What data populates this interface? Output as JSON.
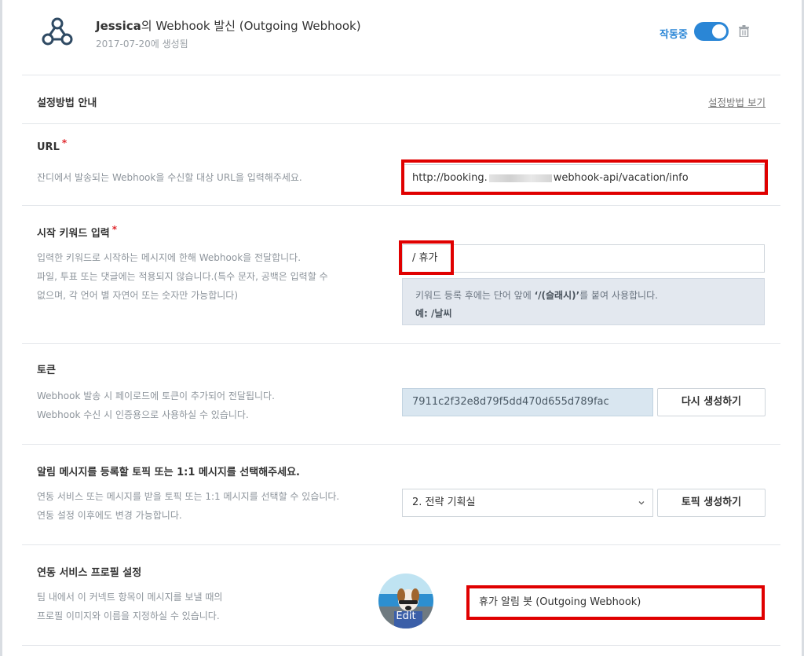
{
  "header": {
    "owner_name": "Jessica",
    "title_rest": "의 Webhook 발신 (Outgoing Webhook)",
    "created": "2017-07-20에 생성됨",
    "status_label": "작동중",
    "toggle_on": true,
    "logo_icon": "webhook-icon",
    "trash_icon": "trash-icon"
  },
  "guide": {
    "title": "설정방법 안내",
    "link": "설정방법 보기"
  },
  "url_section": {
    "title": "URL",
    "required_mark": "*",
    "description": "잔디에서 발송되는 Webhook을 수신할 대상 URL을 입력해주세요.",
    "value_prefix": "http://booking.",
    "value_suffix": "webhook-api/vacation/info"
  },
  "keyword_section": {
    "title": "시작 키워드 입력",
    "required_mark": "*",
    "description_lines": [
      "입력한 키워드로 시작하는 메시지에 한해 Webhook을 전달합니다.",
      "파일, 투표 또는 댓글에는 적용되지 않습니다.(특수 문자, 공백은 입력할 수",
      "없으며, 각 언어 별 자연어 또는 숫자만 가능합니다)"
    ],
    "value": "/ 휴가",
    "hint_line1": "키워드 등록 후에는 단어 앞에 ",
    "hint_bold": "‘/(슬래시)’",
    "hint_line1_end": "를 붙여 사용합니다.",
    "hint_example": "예: /날씨"
  },
  "token_section": {
    "title": "토큰",
    "description_lines": [
      "Webhook 발송 시 페이로드에 토큰이 추가되어 전달됩니다.",
      "Webhook 수신 시 인증용으로 사용하실 수 있습니다."
    ],
    "token_value": "7911c2f32e8d79f5dd470d655d789fac",
    "regenerate_button": "다시 생성하기"
  },
  "topic_section": {
    "title": "알림 메시지를 등록할 토픽 또는 1:1 메시지를 선택해주세요.",
    "description_lines": [
      "연동 서비스 또는 메시지를 받을 토픽 또는 1:1 메시지를 선택할 수 있습니다.",
      "연동 설정 이후에도 변경 가능합니다."
    ],
    "selected_topic": "2. 전략 기획실",
    "create_topic_button": "토픽 생성하기"
  },
  "profile_section": {
    "title": "연동 서비스 프로필 설정",
    "description_lines": [
      "팀 내에서 이 커넥트 항목이 메시지를 보낼 때의",
      "프로필 이미지와 이름을 지정하실 수 있습니다."
    ],
    "avatar_edit_label": "Edit",
    "bot_name": "휴가 알림 봇 (Outgoing Webhook)"
  },
  "colors": {
    "accent": "#2a86d6",
    "highlight_border": "#e00000",
    "required": "#e0262b"
  }
}
